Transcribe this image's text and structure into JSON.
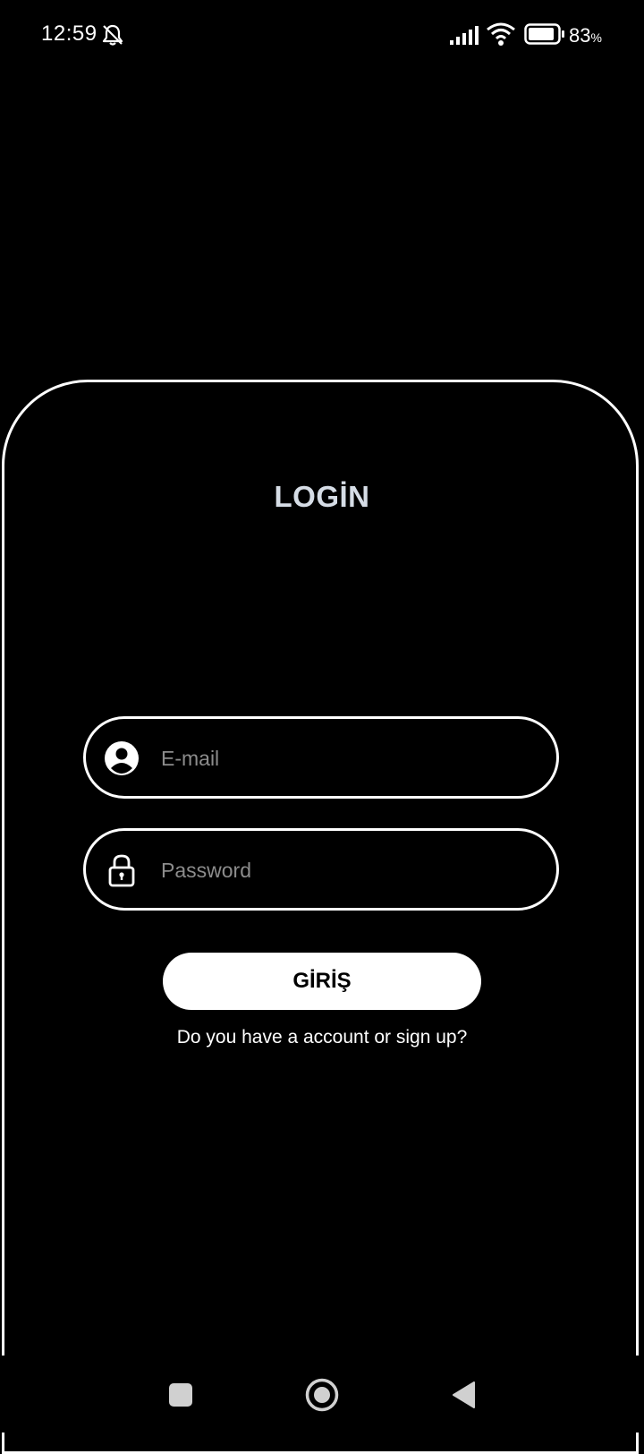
{
  "status_bar": {
    "time": "12:59",
    "battery_percent": "83",
    "battery_unit": "%",
    "icons": [
      "bell-off-icon",
      "signal-icon",
      "wifi-icon",
      "battery-icon"
    ]
  },
  "login": {
    "title": "LOGİN",
    "email_placeholder": "E-mail",
    "password_placeholder": "Password",
    "submit_label": "GİRİŞ",
    "signup_prompt": "Do you have a account or sign up?"
  },
  "nav_bar": {
    "icons": [
      "recents-icon",
      "home-icon",
      "back-icon"
    ]
  },
  "colors": {
    "background": "#000000",
    "border": "#ffffff",
    "title": "#d6dde6",
    "placeholder": "#8c8c8c",
    "button_bg": "#ffffff",
    "button_text": "#000000"
  }
}
